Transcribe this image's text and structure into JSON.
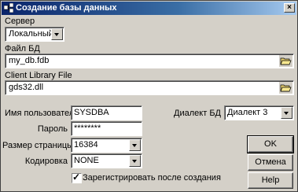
{
  "window": {
    "title": "Создание базы данных"
  },
  "server": {
    "label": "Сервер",
    "value": "Локальный"
  },
  "db_file": {
    "label": "Файл БД",
    "value": "my_db.fdb"
  },
  "client_lib": {
    "label": "Client Library File",
    "value": "gds32.dll"
  },
  "username": {
    "label": "Имя пользователя",
    "value": "SYSDBA"
  },
  "password": {
    "label": "Пароль",
    "value": "********"
  },
  "page_size": {
    "label": "Размер страницы БД",
    "value": "16384"
  },
  "encoding": {
    "label": "Кодировка",
    "value": "NONE"
  },
  "dialect": {
    "label": "Диалект БД",
    "value": "Диалект 3"
  },
  "register": {
    "label": "Зарегистрировать после создания",
    "checked": true
  },
  "buttons": {
    "ok": "OK",
    "cancel": "Отмена",
    "help": "Help"
  },
  "icons": {
    "app": "database-app-icon",
    "folder": "open-folder-icon",
    "close": "close-icon",
    "dropdown": "chevron-down-icon"
  }
}
